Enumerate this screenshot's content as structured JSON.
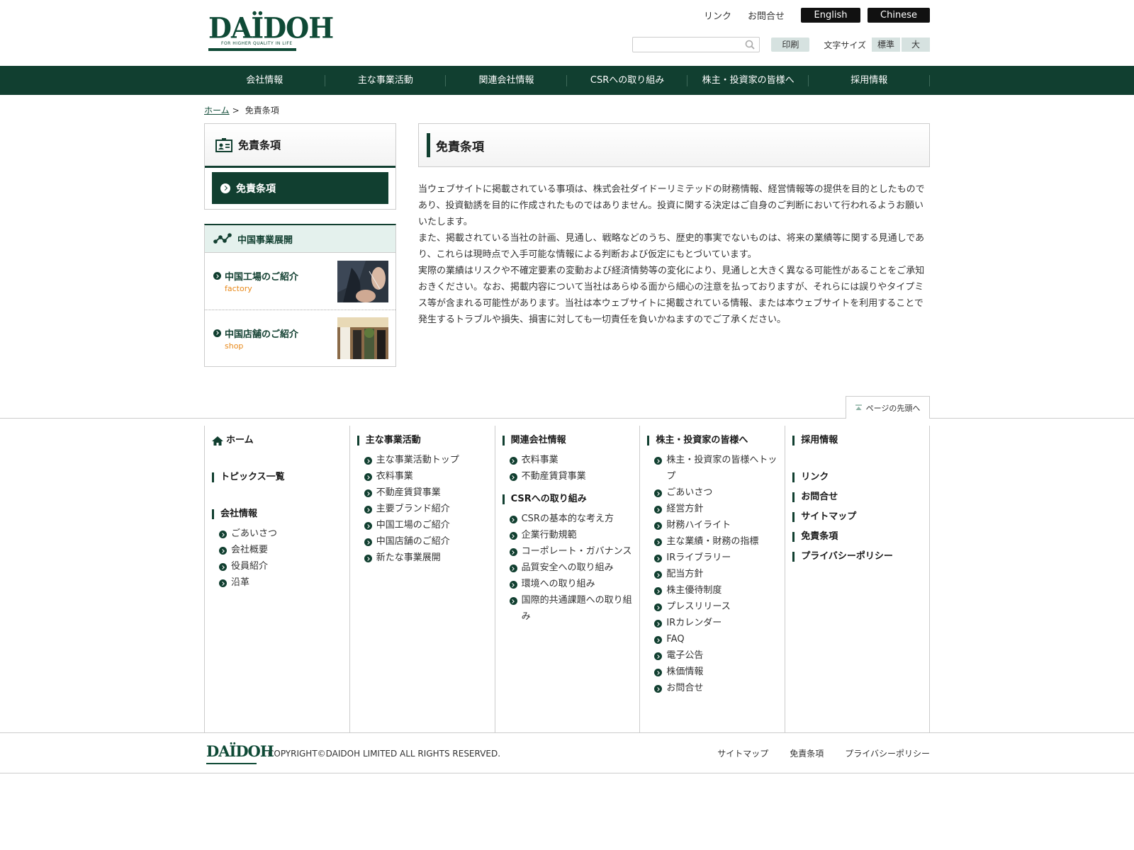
{
  "header": {
    "logo_text": "DAÏDOH",
    "logo_tagline": "FOR HIGHER QUALITY IN LIFE",
    "links": [
      "リンク",
      "お問合せ"
    ],
    "lang_en": "English",
    "lang_zh": "Chinese",
    "search_placeholder": "",
    "print_label": "印刷",
    "font_size_label": "文字サイズ",
    "font_size_options": [
      "標準",
      "大"
    ]
  },
  "nav": [
    "会社情報",
    "主な事業活動",
    "関連会社情報",
    "CSRへの取り組み",
    "株主・投資家の皆様へ",
    "採用情報"
  ],
  "breadcrumb": {
    "home": "ホーム",
    "separator": ">",
    "current": "免責条項"
  },
  "sidebar": {
    "title": "免責条項",
    "menu": [
      "免責条項"
    ],
    "china": {
      "title": "中国事業展開",
      "items": [
        {
          "title": "中国工場のご紹介",
          "sub": "factory"
        },
        {
          "title": "中国店舗のご紹介",
          "sub": "shop"
        }
      ]
    }
  },
  "main": {
    "title": "免責条項",
    "paragraphs": [
      "当ウェブサイトに掲載されている事項は、株式会社ダイドーリミテッドの財務情報、経営情報等の提供を目的としたものであり、投資勧誘を目的に作成されたものではありません。投資に関する決定はご自身のご判断において行われるようお願いいたします。",
      "また、掲載されている当社の計画、見通し、戦略などのうち、歴史的事実でないものは、将来の業績等に関する見通しであり、これらは現時点で入手可能な情報による判断および仮定にもとづいています。",
      "実際の業績はリスクや不確定要素の変動および経済情勢等の変化により、見通しと大きく異なる可能性があることをご承知おきください。なお、掲載内容について当社はあらゆる面から細心の注意を払っておりますが、それらには誤りやタイプミス等が含まれる可能性があります。当社は本ウェブサイトに掲載されている情報、または本ウェブサイトを利用することで発生するトラブルや損失、損害に対しても一切責任を負いかねますのでご了承ください。"
    ]
  },
  "pagetop": "ページの先頭へ",
  "sitemap": {
    "col1": {
      "home": "ホーム",
      "topics": "トピックス一覧",
      "company": "会社情報",
      "company_items": [
        "ごあいさつ",
        "会社概要",
        "役員紹介",
        "沿革"
      ]
    },
    "col2": {
      "title": "主な事業活動",
      "items": [
        "主な事業活動トップ",
        "衣料事業",
        "不動産賃貸事業",
        "主要ブランド紹介",
        "中国工場のご紹介",
        "中国店舗のご紹介",
        "新たな事業展開"
      ]
    },
    "col3": {
      "title": "関連会社情報",
      "items": [
        "衣料事業",
        "不動産賃貸事業"
      ],
      "csr_title": "CSRへの取り組み",
      "csr_items": [
        "CSRの基本的な考え方",
        "企業行動規範",
        "コーポレート・ガバナンス",
        "品質安全への取り組み",
        "環境への取り組み",
        "国際的共通課題への取り組み"
      ]
    },
    "col4": {
      "title": "株主・投資家の皆様へ",
      "items": [
        "株主・投資家の皆様へトップ",
        "ごあいさつ",
        "経営方針",
        "財務ハイライト",
        "主な業績・財務の指標",
        "IRライブラリー",
        "配当方針",
        "株主優待制度",
        "プレスリリース",
        "IRカレンダー",
        "FAQ",
        "電子公告",
        "株価情報",
        "お問合せ"
      ]
    },
    "col5": {
      "recruit": "採用情報",
      "others": [
        "リンク",
        "お問合せ",
        "サイトマップ",
        "免責条項",
        "プライバシーポリシー"
      ]
    }
  },
  "footer": {
    "logo_text": "DAÏDOH",
    "copyright": "COPYRIGHT©DAIDOH LIMITED ALL RIGHTS RESERVED.",
    "links": [
      "サイトマップ",
      "免責条項",
      "プライバシーポリシー"
    ]
  },
  "colors": {
    "brand_green": "#113f30",
    "accent_orange": "#e8891a",
    "light_green_bg": "#e4f1ed"
  }
}
